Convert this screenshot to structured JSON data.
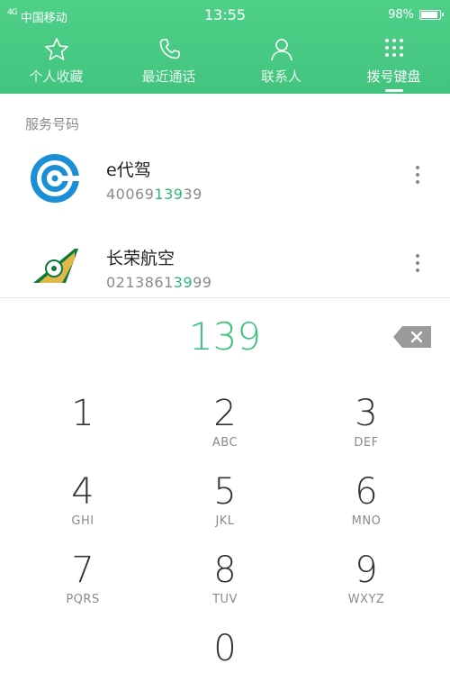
{
  "status_bar": {
    "signal": "4G",
    "carrier": "中国移动",
    "time": "13:55",
    "battery": "98%"
  },
  "tabs": [
    {
      "label": "个人收藏",
      "icon": "star-icon"
    },
    {
      "label": "最近通话",
      "icon": "phone-icon"
    },
    {
      "label": "联系人",
      "icon": "person-icon"
    },
    {
      "label": "拨号键盘",
      "icon": "dialpad-icon",
      "active": true
    }
  ],
  "section_title": "服务号码",
  "results": [
    {
      "name": "e代驾",
      "number_pre": "40069",
      "number_match": "139",
      "number_post": "39",
      "logo": "e-daijia-logo"
    },
    {
      "name": "长荣航空",
      "number_pre": "0213861",
      "number_match": "39",
      "number_post": "99",
      "logo": "eva-air-logo"
    }
  ],
  "dial_input": "139",
  "keys": [
    {
      "digit": "1",
      "letters": ""
    },
    {
      "digit": "2",
      "letters": "ABC"
    },
    {
      "digit": "3",
      "letters": "DEF"
    },
    {
      "digit": "4",
      "letters": "GHI"
    },
    {
      "digit": "5",
      "letters": "JKL"
    },
    {
      "digit": "6",
      "letters": "MNO"
    },
    {
      "digit": "7",
      "letters": "PQRS"
    },
    {
      "digit": "8",
      "letters": "TUV"
    },
    {
      "digit": "9",
      "letters": "WXYZ"
    },
    {
      "digit": "0",
      "letters": ""
    }
  ],
  "colors": {
    "accent": "#3ec07c",
    "header": "#46c781"
  }
}
